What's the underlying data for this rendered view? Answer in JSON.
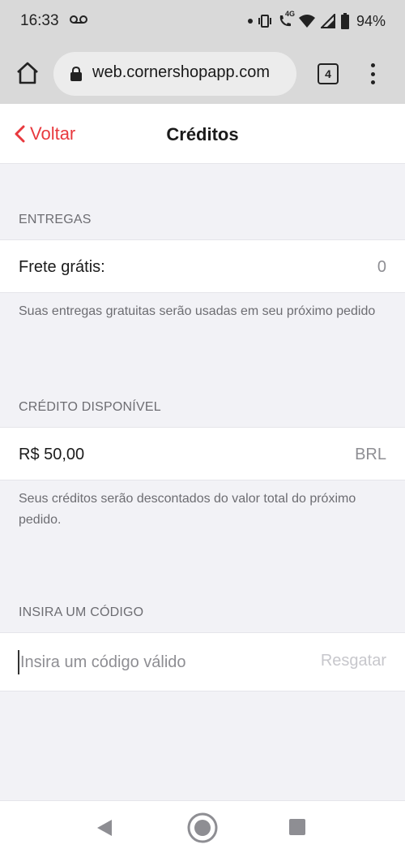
{
  "status_bar": {
    "time": "16:33",
    "battery": "94%",
    "network": "4G"
  },
  "browser": {
    "url": "web.cornershopapp.com",
    "tab_count": "4"
  },
  "header": {
    "back_label": "Voltar",
    "title": "Créditos"
  },
  "deliveries": {
    "section_label": "ENTREGAS",
    "row_label": "Frete grátis:",
    "row_value": "0",
    "note": "Suas entregas gratuitas serão usadas em seu próximo pedido"
  },
  "credit": {
    "section_label": "CRÉDITO DISPONÍVEL",
    "amount": "R$ 50,00",
    "currency": "BRL",
    "note": "Seus créditos serão descontados do valor total do próximo pedido."
  },
  "code": {
    "section_label": "INSIRA UM CÓDIGO",
    "placeholder": "Insira um código válido",
    "redeem_label": "Resgatar"
  },
  "colors": {
    "accent": "#e8393e",
    "background": "#f2f2f6"
  }
}
